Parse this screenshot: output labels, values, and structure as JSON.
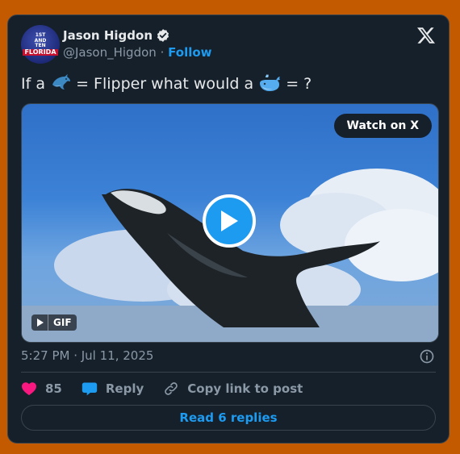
{
  "author": {
    "name": "Jason Higdon",
    "handle": "@Jason_Higdon",
    "separator": "·",
    "follow_label": "Follow",
    "avatar_text": [
      "1ST",
      "AND",
      "TEN",
      "FLORIDA"
    ]
  },
  "tweet": {
    "text_before": "If a ",
    "emoji_1": "dolphin-emoji",
    "text_middle": " = Flipper what would a ",
    "emoji_2": "whale-emoji",
    "text_after": " = ?"
  },
  "media": {
    "watch_label": "Watch on X",
    "badge_label": "GIF",
    "icon": "play-icon"
  },
  "timestamp": "5:27 PM · Jul 11, 2025",
  "actions": {
    "like_count": "85",
    "reply_label": "Reply",
    "copy_label": "Copy link to post"
  },
  "read_replies_label": "Read 6 replies",
  "colors": {
    "accent": "#1D9BF0",
    "background": "#15202B",
    "like": "#F91880",
    "page": "#C45A00"
  }
}
